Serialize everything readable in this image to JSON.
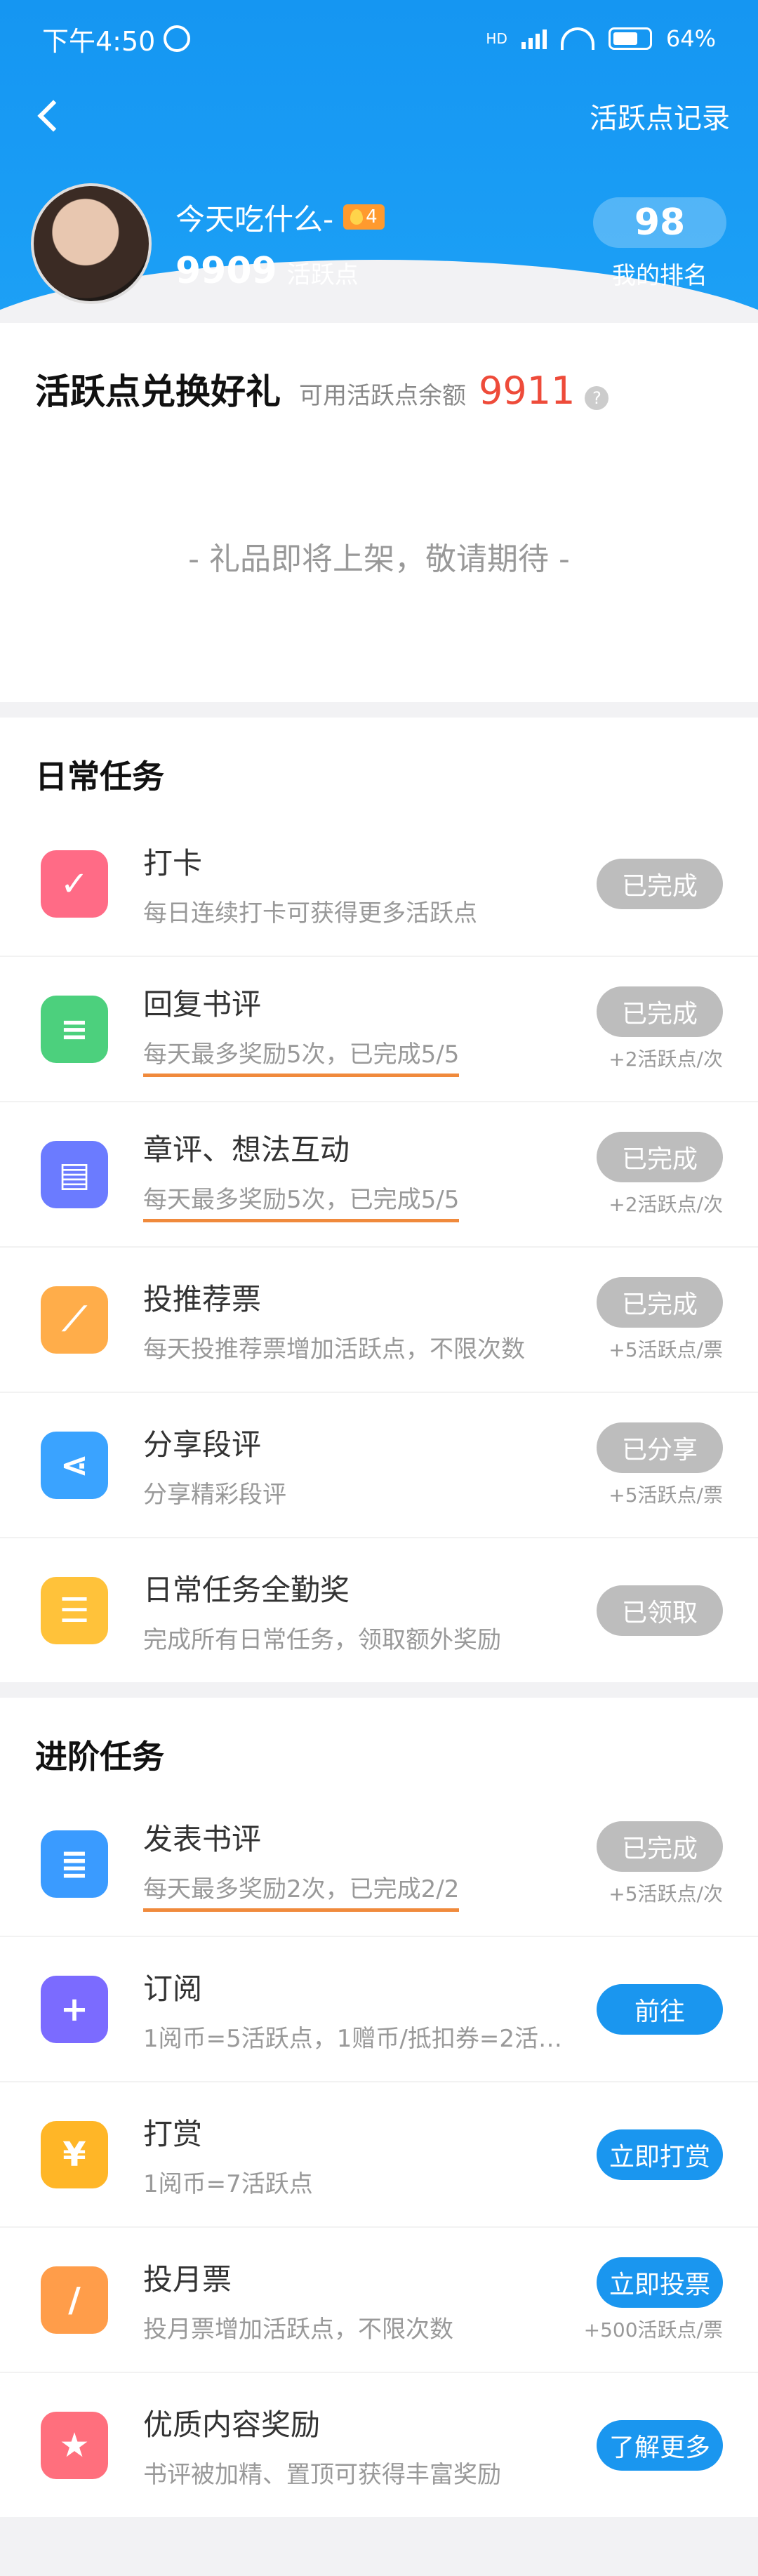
{
  "status": {
    "time": "下午4:50",
    "network": "HD",
    "battery": "64%"
  },
  "nav": {
    "record_link": "活跃点记录"
  },
  "profile": {
    "nickname": "今天吃什么-",
    "badge_level": "4",
    "points": "9909",
    "points_unit": "活跃点",
    "rank_value": "98",
    "rank_label": "我的排名"
  },
  "exchange": {
    "title": "活跃点兑换好礼",
    "balance_label": "可用活跃点余额",
    "balance": "9911",
    "help": "?",
    "coming_soon": "- 礼品即将上架，敬请期待 -"
  },
  "daily": {
    "title": "日常任务",
    "tasks": [
      {
        "name": "打卡",
        "desc": "每日连续打卡可获得更多活跃点",
        "button": "已完成",
        "reward": "",
        "icon": "calendar-check-icon",
        "color": "#ff6b86"
      },
      {
        "name": "回复书评",
        "desc": "每天最多奖励5次，已完成5/5",
        "button": "已完成",
        "reward": "+2活跃点/次",
        "icon": "chat-icon",
        "color": "#4cd07d"
      },
      {
        "name": "章评、想法互动",
        "desc": "每天最多奖励5次，已完成5/5",
        "button": "已完成",
        "reward": "+2活跃点/次",
        "icon": "note-icon",
        "color": "#6b7bff"
      },
      {
        "name": "投推荐票",
        "desc": "每天投推荐票增加活跃点，不限次数",
        "button": "已完成",
        "reward": "+5活跃点/票",
        "icon": "ticket-icon",
        "color": "#ffad4a"
      },
      {
        "name": "分享段评",
        "desc": "分享精彩段评",
        "button": "已分享",
        "reward": "+5活跃点/票",
        "icon": "share-icon",
        "color": "#3aa3ff"
      },
      {
        "name": "日常任务全勤奖",
        "desc": "完成所有日常任务，领取额外奖励",
        "button": "已领取",
        "reward": "",
        "icon": "list-icon",
        "color": "#ffc23a"
      }
    ]
  },
  "advanced": {
    "title": "进阶任务",
    "tasks": [
      {
        "name": "发表书评",
        "desc": "每天最多奖励2次，已完成2/2",
        "button": "已完成",
        "reward": "+5活跃点/次",
        "icon": "document-icon",
        "color": "#3a9bff"
      },
      {
        "name": "订阅",
        "desc": "1阅币=5活跃点，1赠币/抵扣券=2活…",
        "button": "前往",
        "reward": "",
        "icon": "bookmark-plus-icon",
        "color": "#7b6bff"
      },
      {
        "name": "打赏",
        "desc": "1阅币=7活跃点",
        "button": "立即打赏",
        "reward": "",
        "icon": "money-bag-icon",
        "color": "#ffb627"
      },
      {
        "name": "投月票",
        "desc": "投月票增加活跃点，不限次数",
        "button": "立即投票",
        "reward": "+500活跃点/票",
        "icon": "month-ticket-icon",
        "color": "#ff9d4a"
      },
      {
        "name": "优质内容奖励",
        "desc": "书评被加精、置顶可获得丰富奖励",
        "button": "了解更多",
        "reward": "",
        "icon": "star-icon",
        "color": "#ff6f7d"
      }
    ]
  }
}
